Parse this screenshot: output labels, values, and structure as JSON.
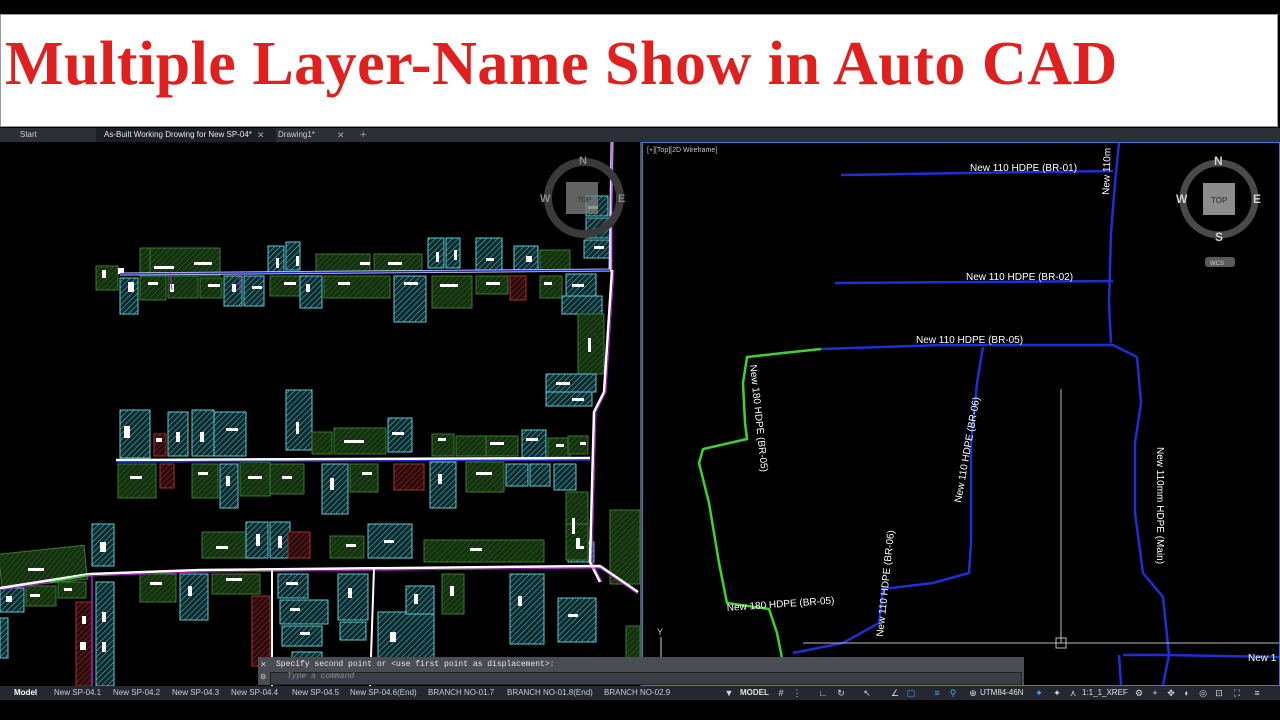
{
  "banner": {
    "title": "Multiple Layer-Name Show in Auto CAD"
  },
  "file_tabs": [
    {
      "label": "Start"
    },
    {
      "label": "As-Built Working Drowing for New SP-04*"
    },
    {
      "label": "Drawing1*"
    }
  ],
  "left_viewport": {
    "compass": {
      "n": "N",
      "w": "W",
      "e": "E",
      "cube_label": "TOP"
    }
  },
  "right_viewport": {
    "label": "[+][Top][2D Wireframe]",
    "compass": {
      "n": "N",
      "s": "S",
      "w": "W",
      "e": "E",
      "cube_label": "TOP",
      "wcs": "WCS"
    },
    "pipe_labels": {
      "br01": "New 110 HDPE (BR-01)",
      "br02": "New 110 HDPE (BR-02)",
      "br05_110": "New 110 HDPE (BR-05)",
      "br05_180_vertical": "New 180 HDPE (BR-05)",
      "br05_180_bottom": "New 180 HDPE (BR-05)",
      "br06_upper": "New 110 HDPE (BR-06)",
      "br06_lower": "New 110 HDPE (BR-06)",
      "main": "New 110mm HDPE (Main)",
      "top_right": "New 110m",
      "bottom_right": "New 1"
    },
    "ucs_y": "Y",
    "colors": {
      "blue_pipe": "#1f2fd6",
      "green_pipe": "#3fd22f"
    }
  },
  "command_line": {
    "history": "Specify second point or <use first point as displacement>:",
    "placeholder": "Type a command"
  },
  "layout_tabs": [
    "Model",
    "New SP-04.1",
    "New SP-04.2",
    "New SP-04.3",
    "New SP-04.4",
    "New SP-04.5",
    "New SP-04.6(End)",
    "BRANCH NO-01.7",
    "BRANCH NO-01.8(End)",
    "BRANCH NO-02.9"
  ],
  "status": {
    "model": "MODEL",
    "coord_system": "UTM84-46N",
    "scale": "1:1_1_XREF"
  }
}
